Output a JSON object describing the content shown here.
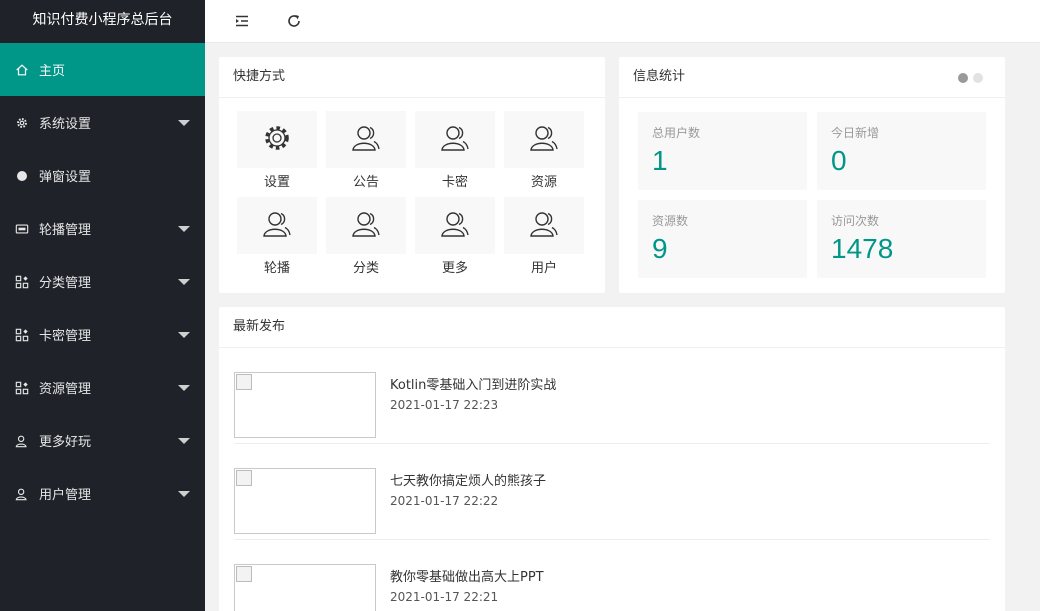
{
  "app": {
    "title": "知识付费小程序总后台"
  },
  "sidebar": {
    "items": [
      {
        "label": "主页",
        "icon": "home-icon",
        "active": true,
        "has_caret": false
      },
      {
        "label": "系统设置",
        "icon": "gear-icon",
        "has_caret": true
      },
      {
        "label": "弹窗设置",
        "icon": "dot-icon",
        "has_caret": false
      },
      {
        "label": "轮播管理",
        "icon": "image-icon",
        "has_caret": true
      },
      {
        "label": "分类管理",
        "icon": "apps-icon",
        "has_caret": true
      },
      {
        "label": "卡密管理",
        "icon": "apps-icon",
        "has_caret": true
      },
      {
        "label": "资源管理",
        "icon": "apps-icon",
        "has_caret": true
      },
      {
        "label": "更多好玩",
        "icon": "user-icon",
        "has_caret": true
      },
      {
        "label": "用户管理",
        "icon": "user-icon",
        "has_caret": true
      }
    ]
  },
  "header": {
    "toggle_icon": "menu-indent-icon",
    "refresh_icon": "refresh-icon"
  },
  "shortcuts": {
    "title": "快捷方式",
    "items": [
      {
        "label": "设置",
        "icon": "gear-icon"
      },
      {
        "label": "公告",
        "icon": "users-icon"
      },
      {
        "label": "卡密",
        "icon": "users-icon"
      },
      {
        "label": "资源",
        "icon": "users-icon"
      },
      {
        "label": "轮播",
        "icon": "users-icon"
      },
      {
        "label": "分类",
        "icon": "users-icon"
      },
      {
        "label": "更多",
        "icon": "users-icon"
      },
      {
        "label": "用户",
        "icon": "users-icon"
      }
    ]
  },
  "stats": {
    "title": "信息统计",
    "items": [
      {
        "label": "总用户数",
        "value": "1"
      },
      {
        "label": "今日新增",
        "value": "0"
      },
      {
        "label": "资源数",
        "value": "9"
      },
      {
        "label": "访问次数",
        "value": "1478"
      }
    ]
  },
  "latest": {
    "title": "最新发布",
    "posts": [
      {
        "title": "Kotlin零基础入门到进阶实战",
        "time": "2021-01-17 22:23"
      },
      {
        "title": "七天教你搞定烦人的熊孩子",
        "time": "2021-01-17 22:22"
      },
      {
        "title": "教你零基础做出高大上PPT",
        "time": "2021-01-17 22:21"
      }
    ]
  },
  "colors": {
    "accent": "#009688",
    "sidebar_bg": "#20222a"
  }
}
